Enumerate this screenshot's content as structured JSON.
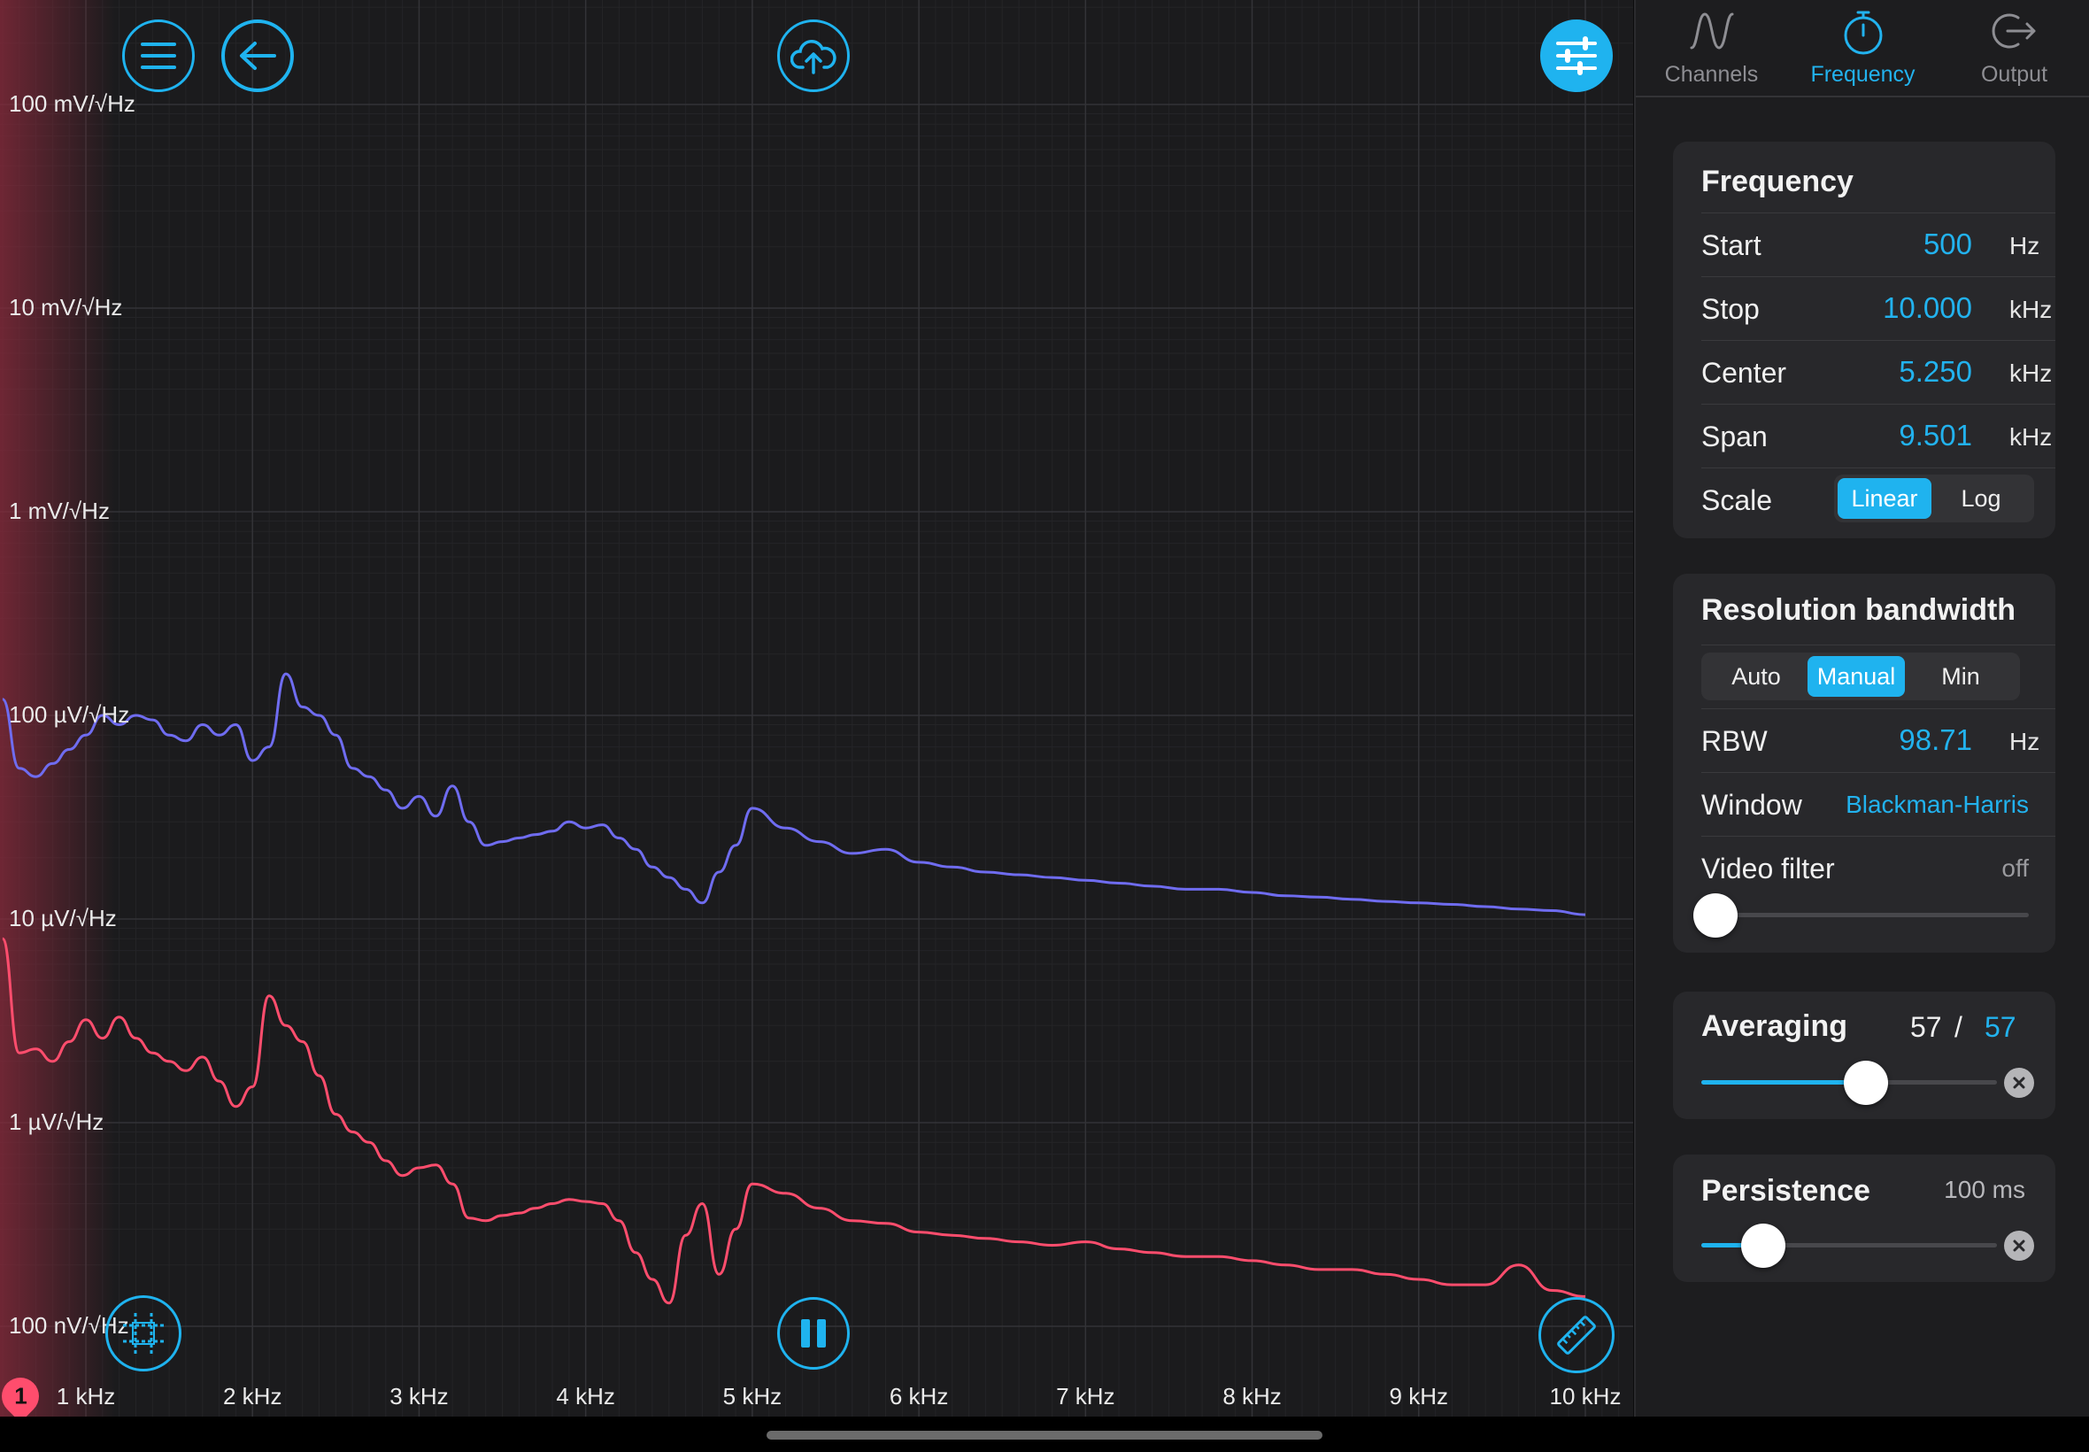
{
  "plot": {
    "y_labels": [
      "100 mV/√Hz",
      "10 mV/√Hz",
      "1 mV/√Hz",
      "100 µV/√Hz",
      "10 µV/√Hz",
      "1 µV/√Hz",
      "100 nV/√Hz"
    ],
    "x_labels": [
      "1 kHz",
      "2 kHz",
      "3 kHz",
      "4 kHz",
      "5 kHz",
      "6 kHz",
      "7 kHz",
      "8 kHz",
      "9 kHz",
      "10 kHz"
    ],
    "channel_marker": "1",
    "colors": {
      "trace_blue": "#6f6cf0",
      "trace_red": "#ff4d6d",
      "accent": "#1fb3ef"
    }
  },
  "chart_data": {
    "type": "line",
    "x_scale": "linear",
    "y_scale": "log",
    "xlim_hz": [
      500,
      10000
    ],
    "ylim_v_per_rthz": [
      1e-07,
      0.1
    ],
    "series": [
      {
        "x_hz": [
          500,
          600,
          700,
          800,
          900,
          1000,
          1100,
          1200,
          1300,
          1400,
          1500,
          1600,
          1700,
          1800,
          1900,
          2000,
          2100,
          2200,
          2300,
          2400,
          2500,
          2600,
          2700,
          2800,
          2900,
          3000,
          3100,
          3200,
          3300,
          3400,
          3500,
          3600,
          3700,
          3800,
          3900,
          4000,
          4100,
          4200,
          4300,
          4400,
          4500,
          4600,
          4700,
          4800,
          4900,
          5000,
          5200,
          5400,
          5600,
          5800,
          6000,
          6200,
          6400,
          6600,
          6800,
          7000,
          7200,
          7400,
          7600,
          7800,
          8000,
          8200,
          8400,
          8600,
          8800,
          9000,
          9200,
          9400,
          9600,
          9800,
          10000
        ],
        "y": [
          0.00012,
          5.5e-05,
          5e-05,
          5.8e-05,
          6.8e-05,
          8e-05,
          0.0001,
          9e-05,
          0.0001,
          9.5e-05,
          8e-05,
          7.5e-05,
          9e-05,
          8e-05,
          9e-05,
          6e-05,
          7e-05,
          0.00016,
          0.00011,
          0.0001,
          8e-05,
          5.5e-05,
          5e-05,
          4.3e-05,
          3.5e-05,
          4e-05,
          3.2e-05,
          4.5e-05,
          3e-05,
          2.3e-05,
          2.4e-05,
          2.5e-05,
          2.6e-05,
          2.7e-05,
          3e-05,
          2.8e-05,
          2.9e-05,
          2.5e-05,
          2.2e-05,
          1.8e-05,
          1.6e-05,
          1.4e-05,
          1.2e-05,
          1.7e-05,
          2.3e-05,
          3.5e-05,
          2.8e-05,
          2.4e-05,
          2.1e-05,
          2.2e-05,
          1.9e-05,
          1.8e-05,
          1.7e-05,
          1.65e-05,
          1.6e-05,
          1.55e-05,
          1.5e-05,
          1.45e-05,
          1.4e-05,
          1.4e-05,
          1.35e-05,
          1.3e-05,
          1.28e-05,
          1.25e-05,
          1.22e-05,
          1.2e-05,
          1.18e-05,
          1.15e-05,
          1.12e-05,
          1.1e-05,
          1.05e-05
        ]
      },
      {
        "x_hz": [
          500,
          600,
          700,
          800,
          900,
          1000,
          1100,
          1200,
          1300,
          1400,
          1500,
          1600,
          1700,
          1800,
          1900,
          2000,
          2100,
          2200,
          2300,
          2400,
          2500,
          2600,
          2700,
          2800,
          2900,
          3000,
          3100,
          3200,
          3300,
          3400,
          3500,
          3600,
          3700,
          3800,
          3900,
          4000,
          4100,
          4200,
          4300,
          4400,
          4500,
          4600,
          4700,
          4800,
          4900,
          5000,
          5200,
          5400,
          5600,
          5800,
          6000,
          6200,
          6400,
          6600,
          6800,
          7000,
          7200,
          7400,
          7600,
          7800,
          8000,
          8200,
          8400,
          8600,
          8800,
          9000,
          9200,
          9400,
          9600,
          9800,
          10000
        ],
        "y": [
          8e-06,
          2.2e-06,
          2.3e-06,
          2e-06,
          2.5e-06,
          3.2e-06,
          2.6e-06,
          3.3e-06,
          2.6e-06,
          2.2e-06,
          2e-06,
          1.8e-06,
          2.1e-06,
          1.6e-06,
          1.2e-06,
          1.5e-06,
          4.2e-06,
          3e-06,
          2.5e-06,
          1.7e-06,
          1.1e-06,
          9e-07,
          8e-07,
          6.5e-07,
          5.5e-07,
          6e-07,
          6.2e-07,
          5e-07,
          3.4e-07,
          3.3e-07,
          3.5e-07,
          3.6e-07,
          3.8e-07,
          4e-07,
          4.2e-07,
          4.1e-07,
          4e-07,
          3.3e-07,
          2.3e-07,
          1.7e-07,
          1.3e-07,
          2.8e-07,
          4e-07,
          1.8e-07,
          3e-07,
          5e-07,
          4.5e-07,
          3.8e-07,
          3.3e-07,
          3.2e-07,
          2.9e-07,
          2.8e-07,
          2.7e-07,
          2.6e-07,
          2.5e-07,
          2.6e-07,
          2.4e-07,
          2.3e-07,
          2.2e-07,
          2.2e-07,
          2.1e-07,
          2e-07,
          1.9e-07,
          1.9e-07,
          1.8e-07,
          1.7e-07,
          1.6e-07,
          1.6e-07,
          2e-07,
          1.5e-07,
          1.4e-07
        ]
      }
    ]
  },
  "toolbar": {
    "menu_icon": "hamburger-menu-icon",
    "back_icon": "arrow-left-icon",
    "upload_icon": "cloud-upload-icon",
    "settings_icon": "sliders-icon",
    "grid_icon": "grid-icon",
    "pause_icon": "pause-icon",
    "ruler_icon": "ruler-icon"
  },
  "tabs": [
    {
      "label": "Channels",
      "icon": "wave-icon"
    },
    {
      "label": "Frequency",
      "icon": "stopwatch-icon"
    },
    {
      "label": "Output",
      "icon": "export-icon"
    }
  ],
  "frequency": {
    "title": "Frequency",
    "start": {
      "label": "Start",
      "value": "500",
      "unit": "Hz"
    },
    "stop": {
      "label": "Stop",
      "value": "10.000",
      "unit": "kHz"
    },
    "center": {
      "label": "Center",
      "value": "5.250",
      "unit": "kHz"
    },
    "span": {
      "label": "Span",
      "value": "9.501",
      "unit": "kHz"
    },
    "scale": {
      "label": "Scale",
      "options": [
        "Linear",
        "Log"
      ],
      "selected": "Linear"
    }
  },
  "rbw": {
    "title": "Resolution bandwidth",
    "modes": [
      "Auto",
      "Manual",
      "Min"
    ],
    "selected_mode": "Manual",
    "rbw": {
      "label": "RBW",
      "value": "98.71",
      "unit": "Hz"
    },
    "window": {
      "label": "Window",
      "value": "Blackman-Harris"
    },
    "video_filter": {
      "label": "Video filter",
      "value": "off",
      "level": 0
    }
  },
  "averaging": {
    "title": "Averaging",
    "current": "57",
    "separator": "/",
    "target": "57",
    "level": 0.56
  },
  "persistence": {
    "title": "Persistence",
    "value": "100 ms",
    "level": 0.21
  }
}
